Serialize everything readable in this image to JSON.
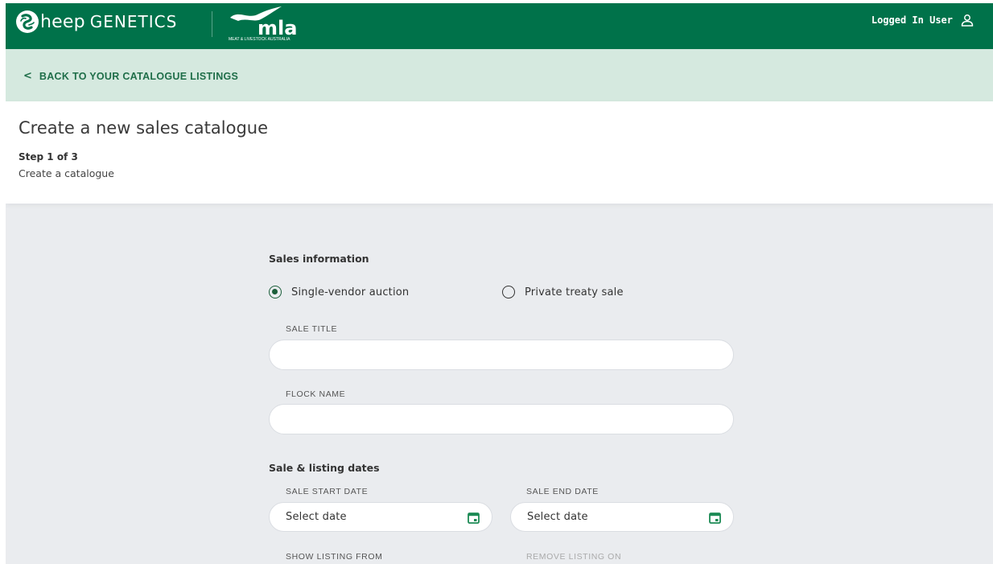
{
  "header": {
    "logo_sheep_text": "heep",
    "logo_genetics_text": "GENETICS",
    "logo_mla_text": "mla",
    "logo_mla_subtext": "MEAT & LIVESTOCK AUSTRALIA",
    "user_label": "Logged In User",
    "user_icon": "user-icon",
    "brand_color": "#00724a"
  },
  "backbar": {
    "chevron": "<",
    "label": "BACK TO YOUR CATALOGUE LISTINGS",
    "bg_color": "#d5e9df"
  },
  "page": {
    "title": "Create a new sales catalogue",
    "step": "Step 1 of 3",
    "step_description": "Create a catalogue"
  },
  "sales_information": {
    "title": "Sales information",
    "sale_types": [
      {
        "label": "Single-vendor auction",
        "selected": true
      },
      {
        "label": "Private treaty sale",
        "selected": false
      }
    ],
    "sale_title": {
      "label": "SALE TITLE",
      "value": ""
    },
    "flock_name": {
      "label": "FLOCK NAME",
      "value": ""
    }
  },
  "dates": {
    "title": "Sale & listing dates",
    "sale_start": {
      "label": "SALE START DATE",
      "placeholder": "Select date"
    },
    "sale_end": {
      "label": "SALE END DATE",
      "placeholder": "Select date"
    },
    "show_listing_from": {
      "label": "SHOW LISTING FROM"
    },
    "remove_listing_on": {
      "label": "REMOVE LISTING ON"
    },
    "calendar_icon_color": "#1b8a54"
  }
}
